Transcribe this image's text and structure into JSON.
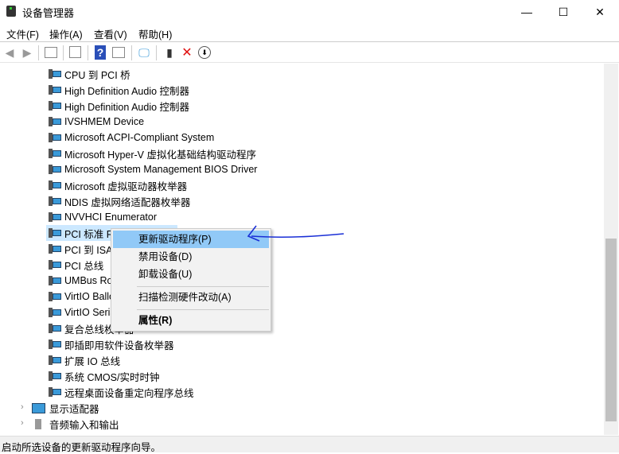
{
  "window": {
    "title": "设备管理器",
    "min": "—",
    "max": "☐",
    "close": "✕"
  },
  "menu": [
    "文件(F)",
    "操作(A)",
    "查看(V)",
    "帮助(H)"
  ],
  "toolbar": {
    "icons": [
      "back-icon",
      "forward-icon",
      "show-hide-tree-icon",
      "properties-icon",
      "help-icon",
      "action-pane-icon",
      "scan-hardware-icon",
      "update-driver-icon",
      "uninstall-icon",
      "disable-icon"
    ]
  },
  "tree": {
    "items": [
      "CPU 到 PCI 桥",
      "High Definition Audio 控制器",
      "High Definition Audio 控制器",
      "IVSHMEM Device",
      "Microsoft ACPI-Compliant System",
      "Microsoft Hyper-V 虚拟化基础结构驱动程序",
      "Microsoft System Management BIOS Driver",
      "Microsoft 虚拟驱动器枚举器",
      "NDIS 虚拟网络适配器枚举器",
      "NVVHCI Enumerator",
      "PCI 标准 RAM Controller",
      "PCI 到 ISA 桥",
      "PCI 总线",
      "UMBus Root Bus Enumerator",
      "VirtIO Balloon Driver",
      "VirtIO Serial Driver",
      "复合总线枚举器",
      "即插即用软件设备枚举器",
      "扩展 IO 总线",
      "系统 CMOS/实时时钟",
      "远程桌面设备重定向程序总线"
    ],
    "selected_index": 10,
    "categories": [
      "显示适配器",
      "音频输入和输出"
    ]
  },
  "context_menu": {
    "items": [
      "更新驱动程序(P)",
      "禁用设备(D)",
      "卸载设备(U)",
      "扫描检测硬件改动(A)",
      "属性(R)"
    ],
    "highlighted": 0
  },
  "status": "启动所选设备的更新驱动程序向导。",
  "colors": {
    "highlight": "#91c9f7",
    "selection": "#cce8ff",
    "annotation": "#1a2fd6"
  }
}
